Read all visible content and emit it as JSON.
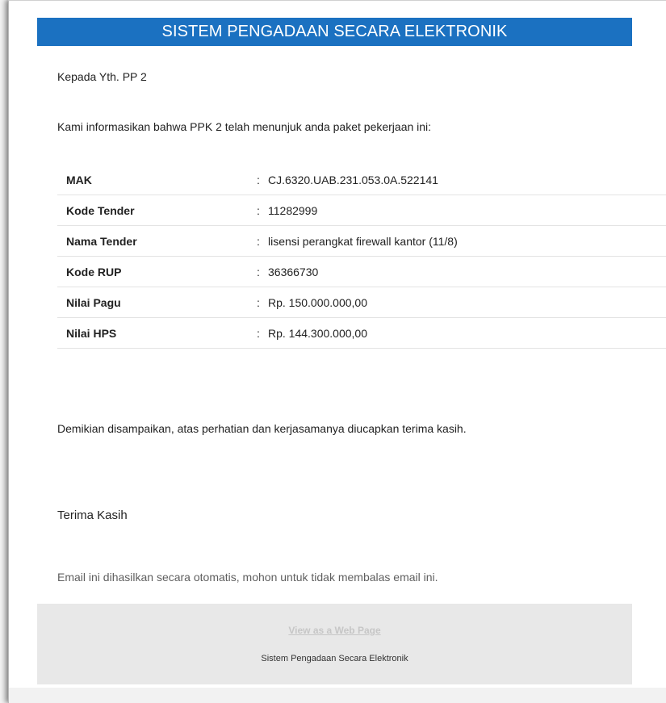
{
  "header": {
    "title": "SISTEM PENGADAAN SECARA ELEKTRONIK",
    "color": "#1b71c1"
  },
  "email": {
    "greeting": "Kepada Yth. PP 2",
    "intro": "Kami informasikan bahwa PPK 2 telah menunjuk anda paket pekerjaan ini:",
    "details": [
      {
        "label": "MAK",
        "value": "CJ.6320.UAB.231.053.0A.522141"
      },
      {
        "label": "Kode Tender",
        "value": "11282999"
      },
      {
        "label": "Nama Tender",
        "value": "lisensi perangkat firewall kantor (11/8)"
      },
      {
        "label": "Kode RUP",
        "value": "36366730"
      },
      {
        "label": "Nilai Pagu",
        "value": "Rp. 150.000.000,00"
      },
      {
        "label": "Nilai HPS",
        "value": "Rp. 144.300.000,00"
      }
    ],
    "separator": ":",
    "closing": "Demikian disampaikan, atas perhatian dan kerjasamanya diucapkan terima kasih.",
    "thanks": "Terima Kasih",
    "auto_notice": "Email ini dihasilkan secara otomatis, mohon untuk tidak membalas email ini."
  },
  "footer": {
    "web_link": "View as a Web Page",
    "org_name": "Sistem Pengadaan Secara Elektronik"
  }
}
